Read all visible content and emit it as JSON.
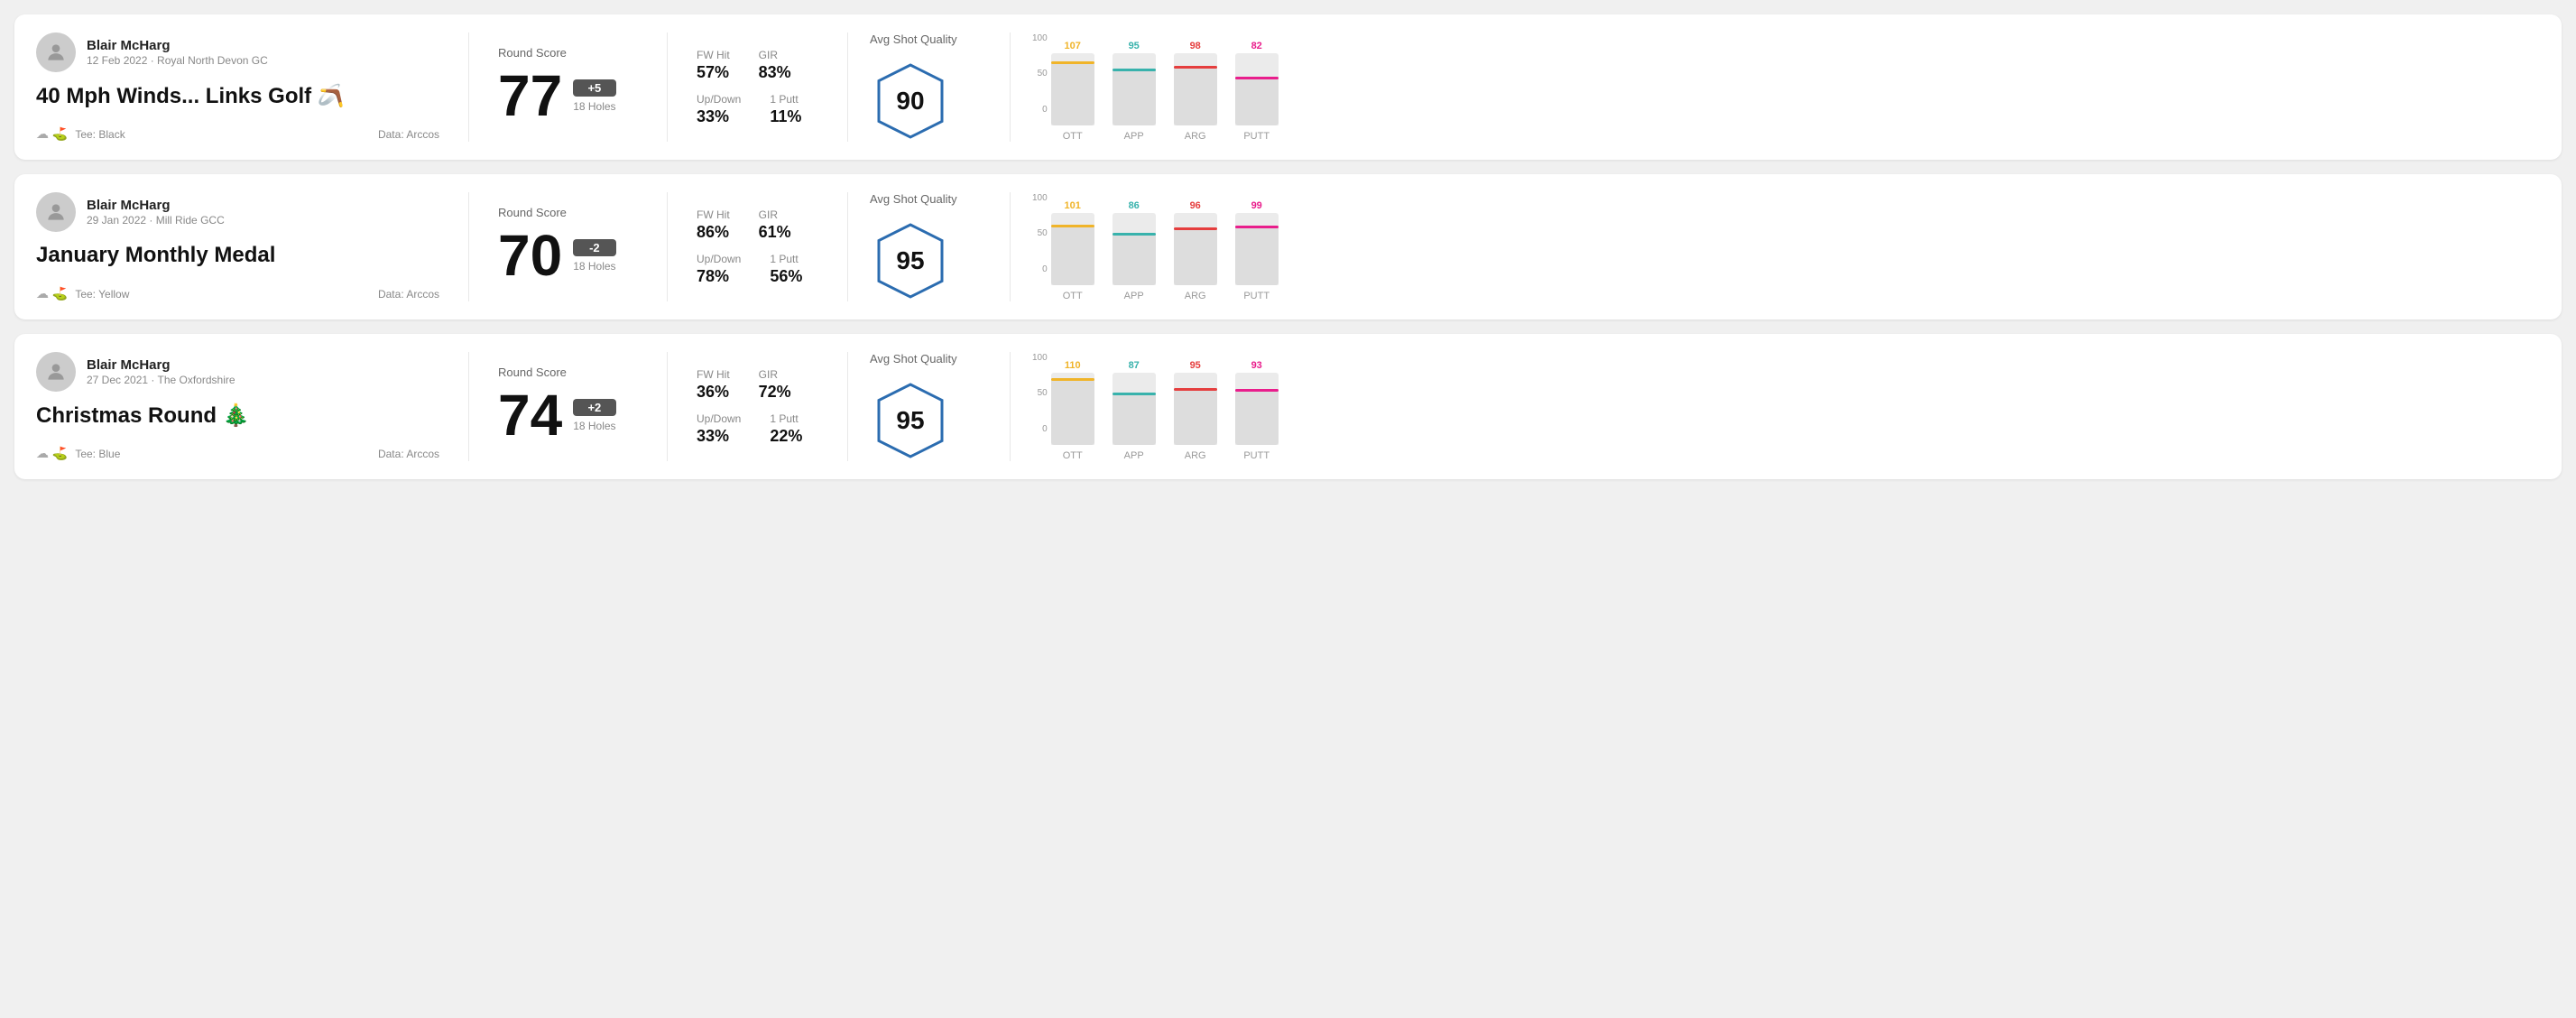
{
  "rounds": [
    {
      "id": "round1",
      "player_name": "Blair McHarg",
      "date": "12 Feb 2022 · Royal North Devon GC",
      "title": "40 Mph Winds... Links Golf 🪃",
      "tee": "Tee: Black",
      "data_source": "Data: Arccos",
      "score": "77",
      "score_diff": "+5",
      "holes": "18 Holes",
      "fw_hit": "57%",
      "gir": "83%",
      "up_down": "33%",
      "one_putt": "11%",
      "avg_quality": "90",
      "chart": {
        "bars": [
          {
            "label": "OTT",
            "value": 107,
            "max": 120,
            "color": "#f0b429",
            "height_pct": 89
          },
          {
            "label": "APP",
            "value": 95,
            "max": 120,
            "color": "#38b2ac",
            "height_pct": 79
          },
          {
            "label": "ARG",
            "value": 98,
            "max": 120,
            "color": "#e53e3e",
            "height_pct": 82
          },
          {
            "label": "PUTT",
            "value": 82,
            "max": 120,
            "color": "#e91e8c",
            "height_pct": 68
          }
        ]
      }
    },
    {
      "id": "round2",
      "player_name": "Blair McHarg",
      "date": "29 Jan 2022 · Mill Ride GCC",
      "title": "January Monthly Medal",
      "tee": "Tee: Yellow",
      "data_source": "Data: Arccos",
      "score": "70",
      "score_diff": "-2",
      "holes": "18 Holes",
      "fw_hit": "86%",
      "gir": "61%",
      "up_down": "78%",
      "one_putt": "56%",
      "avg_quality": "95",
      "chart": {
        "bars": [
          {
            "label": "OTT",
            "value": 101,
            "max": 120,
            "color": "#f0b429",
            "height_pct": 84
          },
          {
            "label": "APP",
            "value": 86,
            "max": 120,
            "color": "#38b2ac",
            "height_pct": 72
          },
          {
            "label": "ARG",
            "value": 96,
            "max": 120,
            "color": "#e53e3e",
            "height_pct": 80
          },
          {
            "label": "PUTT",
            "value": 99,
            "max": 120,
            "color": "#e91e8c",
            "height_pct": 83
          }
        ]
      }
    },
    {
      "id": "round3",
      "player_name": "Blair McHarg",
      "date": "27 Dec 2021 · The Oxfordshire",
      "title": "Christmas Round 🎄",
      "tee": "Tee: Blue",
      "data_source": "Data: Arccos",
      "score": "74",
      "score_diff": "+2",
      "holes": "18 Holes",
      "fw_hit": "36%",
      "gir": "72%",
      "up_down": "33%",
      "one_putt": "22%",
      "avg_quality": "95",
      "chart": {
        "bars": [
          {
            "label": "OTT",
            "value": 110,
            "max": 120,
            "color": "#f0b429",
            "height_pct": 92
          },
          {
            "label": "APP",
            "value": 87,
            "max": 120,
            "color": "#38b2ac",
            "height_pct": 73
          },
          {
            "label": "ARG",
            "value": 95,
            "max": 120,
            "color": "#e53e3e",
            "height_pct": 79
          },
          {
            "label": "PUTT",
            "value": 93,
            "max": 120,
            "color": "#e91e8c",
            "height_pct": 78
          }
        ]
      }
    }
  ],
  "labels": {
    "round_score": "Round Score",
    "avg_shot_quality": "Avg Shot Quality",
    "fw_hit": "FW Hit",
    "gir": "GIR",
    "up_down": "Up/Down",
    "one_putt": "1 Putt",
    "y_axis": [
      "100",
      "50",
      "0"
    ]
  }
}
